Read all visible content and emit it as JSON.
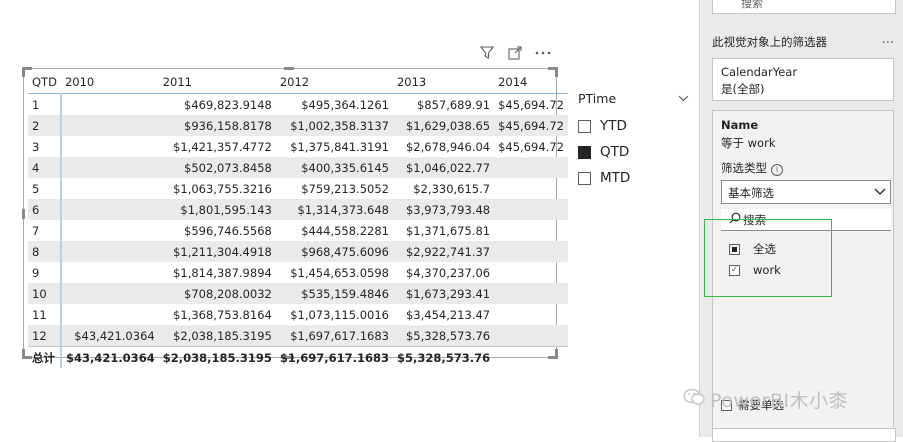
{
  "matrix": {
    "columns": [
      "QTD",
      "2010",
      "2011",
      "2012",
      "2013",
      "2014"
    ],
    "rows": [
      {
        "q": "1",
        "y2010": "",
        "y2011": "$469,823.9148",
        "y2012": "$495,364.1261",
        "y2013": "$857,689.91",
        "y2014": "$45,694.72"
      },
      {
        "q": "2",
        "y2010": "",
        "y2011": "$936,158.8178",
        "y2012": "$1,002,358.3137",
        "y2013": "$1,629,038.65",
        "y2014": "$45,694.72"
      },
      {
        "q": "3",
        "y2010": "",
        "y2011": "$1,421,357.4772",
        "y2012": "$1,375,841.3191",
        "y2013": "$2,678,946.04",
        "y2014": "$45,694.72"
      },
      {
        "q": "4",
        "y2010": "",
        "y2011": "$502,073.8458",
        "y2012": "$400,335.6145",
        "y2013": "$1,046,022.77",
        "y2014": ""
      },
      {
        "q": "5",
        "y2010": "",
        "y2011": "$1,063,755.3216",
        "y2012": "$759,213.5052",
        "y2013": "$2,330,615.7",
        "y2014": ""
      },
      {
        "q": "6",
        "y2010": "",
        "y2011": "$1,801,595.143",
        "y2012": "$1,314,373.648",
        "y2013": "$3,973,793.48",
        "y2014": ""
      },
      {
        "q": "7",
        "y2010": "",
        "y2011": "$596,746.5568",
        "y2012": "$444,558.2281",
        "y2013": "$1,371,675.81",
        "y2014": ""
      },
      {
        "q": "8",
        "y2010": "",
        "y2011": "$1,211,304.4918",
        "y2012": "$968,475.6096",
        "y2013": "$2,922,741.37",
        "y2014": ""
      },
      {
        "q": "9",
        "y2010": "",
        "y2011": "$1,814,387.9894",
        "y2012": "$1,454,653.0598",
        "y2013": "$4,370,237.06",
        "y2014": ""
      },
      {
        "q": "10",
        "y2010": "",
        "y2011": "$708,208.0032",
        "y2012": "$535,159.4846",
        "y2013": "$1,673,293.41",
        "y2014": ""
      },
      {
        "q": "11",
        "y2010": "",
        "y2011": "$1,368,753.8164",
        "y2012": "$1,073,115.0016",
        "y2013": "$3,454,213.47",
        "y2014": ""
      },
      {
        "q": "12",
        "y2010": "$43,421.0364",
        "y2011": "$2,038,185.3195",
        "y2012": "$1,697,617.1683",
        "y2013": "$5,328,573.76",
        "y2014": ""
      }
    ],
    "total": {
      "label": "总计",
      "y2010": "$43,421.0364",
      "y2011": "$2,038,185.3195",
      "y2012": "$1,697,617.1683",
      "y2013": "$5,328,573.76",
      "y2014": ""
    }
  },
  "visual_header": {
    "filter_icon": "filter-icon",
    "focus_icon": "focus-mode-icon",
    "more_icon": "more-options-icon"
  },
  "slicer": {
    "title": "PTime",
    "items": [
      {
        "label": "YTD",
        "checked": false
      },
      {
        "label": "QTD",
        "checked": true
      },
      {
        "label": "MTD",
        "checked": false
      }
    ]
  },
  "filter_pane": {
    "top_search_label": "搜索",
    "section_title": "此视觉对象上的筛选器",
    "more": "...",
    "card1": {
      "field": "CalendarYear",
      "state": "是(全部)"
    },
    "card2": {
      "field": "Name",
      "condition": "等于 work",
      "filter_type_label": "筛选类型",
      "filter_type_value": "基本筛选",
      "search_placeholder": "搜索",
      "options": [
        {
          "label": "全选",
          "state": "partial"
        },
        {
          "label": "work",
          "state": "checked"
        }
      ],
      "require_single": "需要单选"
    }
  },
  "watermark": "PowerBI木小桼",
  "colors": {
    "highlight": "#3cb94d",
    "row_shade": "#eaeaea",
    "pane_bg": "#eaeaea"
  }
}
